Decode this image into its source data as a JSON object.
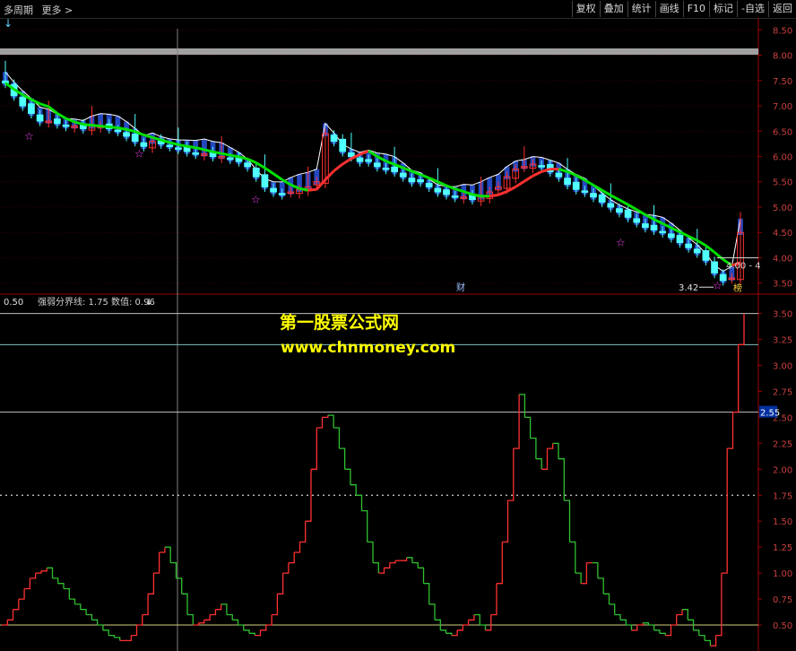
{
  "toolbar": {
    "period_label": "多周期",
    "more_label": "更多 >",
    "buttons": [
      "复权",
      "叠加",
      "统计",
      "画线",
      "F10",
      "标记",
      "-自选",
      "返回"
    ]
  },
  "main_panel": {
    "arrow_glyph": "↓",
    "low_price_label": "3.42",
    "current_price_tag": "4.00 - 4",
    "marker_cai": "财",
    "marker_bang": "榜"
  },
  "indicator_panel": {
    "scale_label": "0.50",
    "title": "强弱分界线: 1.75  数值: 0.96",
    "title_arrow": "↓",
    "highlight_value_tag": "2.55"
  },
  "watermark": {
    "line1": "第一股票公式网",
    "line2": "www.chnmoney.com"
  },
  "colors": {
    "up": "#ff3030",
    "down": "#50ffff",
    "ma": "#00e000",
    "envelope": "#3060ff",
    "indicator_up": "#ff3030",
    "indicator_down": "#30c030",
    "watermark": "#ffff00"
  },
  "chart_data": [
    {
      "type": "candlestick",
      "y_ticks": [
        "8.50",
        "8.00",
        "7.50",
        "7.00",
        "6.50",
        "6.00",
        "5.50",
        "5.00",
        "4.50",
        "4.00",
        "3.50"
      ],
      "ylim": [
        3.3,
        8.7
      ],
      "close_approx": [
        7.45,
        7.2,
        7.0,
        6.85,
        6.7,
        6.7,
        6.65,
        6.6,
        6.6,
        6.55,
        6.6,
        6.6,
        6.55,
        6.5,
        6.4,
        6.3,
        6.2,
        6.3,
        6.25,
        6.2,
        6.15,
        6.1,
        6.05,
        6.05,
        6.0,
        6.0,
        5.95,
        5.9,
        5.8,
        5.6,
        5.4,
        5.3,
        5.25,
        5.3,
        5.35,
        5.4,
        5.5,
        6.45,
        6.3,
        6.1,
        6.0,
        5.9,
        5.9,
        5.8,
        5.75,
        5.7,
        5.6,
        5.5,
        5.5,
        5.4,
        5.3,
        5.25,
        5.2,
        5.2,
        5.15,
        5.2,
        5.3,
        5.4,
        5.6,
        5.75,
        5.8,
        5.85,
        5.8,
        5.7,
        5.6,
        5.45,
        5.35,
        5.3,
        5.2,
        5.1,
        5.0,
        4.9,
        4.8,
        4.7,
        4.6,
        4.55,
        4.5,
        4.4,
        4.3,
        4.2,
        4.1,
        3.95,
        3.7,
        3.55,
        3.6,
        4.5
      ],
      "support_line": 4.0,
      "low_marker": 3.42
    },
    {
      "type": "line",
      "title": "强弱分界线: 1.75  数值: 0.96",
      "y_ticks": [
        "3.50",
        "3.25",
        "3.00",
        "2.75",
        "2.50",
        "2.25",
        "2.00",
        "1.75",
        "1.50",
        "1.25",
        "1.00",
        "0.75",
        "0.50"
      ],
      "ylim": [
        0.25,
        3.6
      ],
      "h_lines": [
        3.5,
        3.2,
        2.55,
        1.75,
        0.5
      ],
      "values": [
        0.5,
        0.55,
        0.65,
        0.75,
        0.85,
        0.95,
        1.0,
        1.02,
        1.05,
        0.95,
        0.9,
        0.85,
        0.75,
        0.7,
        0.65,
        0.6,
        0.55,
        0.5,
        0.45,
        0.4,
        0.38,
        0.35,
        0.35,
        0.4,
        0.5,
        0.6,
        0.8,
        1.0,
        1.2,
        1.25,
        1.1,
        0.95,
        0.8,
        0.6,
        0.5,
        0.52,
        0.55,
        0.6,
        0.65,
        0.7,
        0.6,
        0.55,
        0.5,
        0.45,
        0.42,
        0.4,
        0.45,
        0.5,
        0.6,
        0.8,
        1.0,
        1.1,
        1.2,
        1.3,
        1.5,
        2.0,
        2.4,
        2.5,
        2.52,
        2.4,
        2.2,
        2.0,
        1.85,
        1.75,
        1.6,
        1.3,
        1.1,
        1.0,
        1.05,
        1.1,
        1.12,
        1.12,
        1.15,
        1.1,
        1.05,
        0.9,
        0.7,
        0.55,
        0.45,
        0.42,
        0.4,
        0.45,
        0.5,
        0.55,
        0.6,
        0.5,
        0.45,
        0.6,
        0.9,
        1.3,
        1.7,
        2.2,
        2.72,
        2.5,
        2.3,
        2.1,
        2.0,
        2.2,
        2.25,
        2.1,
        1.7,
        1.3,
        1.0,
        0.9,
        1.1,
        1.1,
        0.95,
        0.8,
        0.7,
        0.6,
        0.55,
        0.5,
        0.45,
        0.5,
        0.52,
        0.5,
        0.45,
        0.42,
        0.4,
        0.5,
        0.6,
        0.65,
        0.55,
        0.45,
        0.4,
        0.35,
        0.3,
        0.4,
        1.0,
        2.2,
        2.55,
        3.2,
        3.5
      ]
    }
  ]
}
